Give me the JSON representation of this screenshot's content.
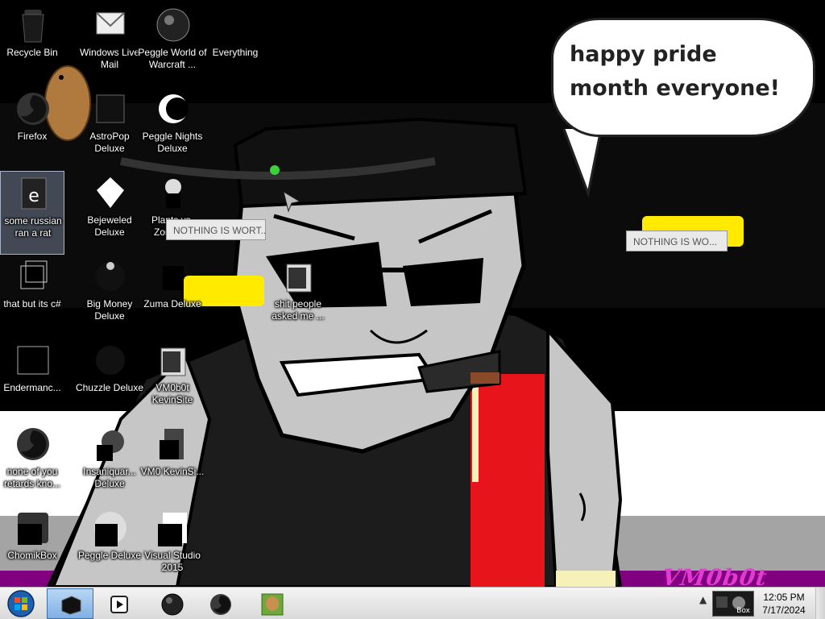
{
  "wallpaper": {
    "speech_bubble": "happy pride month everyone!",
    "signature": "VM0b0t",
    "colors": {
      "stripe_black": "#000000",
      "stripe_gray": "#a4a4a4",
      "stripe_white": "#ffffff",
      "stripe_purple": "#800080",
      "face": "#c6c6c6",
      "red_box": "#e8141c"
    }
  },
  "icons": [
    {
      "label": "Recycle Bin",
      "glyph": "recycle-bin-icon"
    },
    {
      "label": "Windows Live Mail",
      "glyph": "mail-icon"
    },
    {
      "label": "Peggle World of Warcraft ...",
      "glyph": "peggle-wow-icon"
    },
    {
      "label": "Everything",
      "glyph": "everything-icon"
    },
    {
      "label": "Firefox",
      "glyph": "firefox-icon"
    },
    {
      "label": "AstroPop Deluxe",
      "glyph": "astropop-icon"
    },
    {
      "label": "Peggle Nights Deluxe",
      "glyph": "peggle-nights-icon"
    },
    {
      "label": "some russian ran a rat",
      "glyph": "document-icon"
    },
    {
      "label": "Bejeweled Deluxe",
      "glyph": "bejeweled-icon"
    },
    {
      "label": "Plants vs. Zombies",
      "glyph": "pvz-icon"
    },
    {
      "label": "that but its c#",
      "glyph": "shortcut-icon"
    },
    {
      "label": "Big Money Deluxe",
      "glyph": "big-money-icon"
    },
    {
      "label": "Zuma Deluxe",
      "glyph": "zuma-icon"
    },
    {
      "label": "shit people asked me ...",
      "glyph": "folder-icon"
    },
    {
      "label": "Endermanc...",
      "glyph": "app-icon"
    },
    {
      "label": "Chuzzle Deluxe",
      "glyph": "chuzzle-icon"
    },
    {
      "label": "VM0b0t KevinSite",
      "glyph": "folder-icon"
    },
    {
      "label": "none of you retards kno...",
      "glyph": "firefox-icon"
    },
    {
      "label": "Insaniquar... Deluxe",
      "glyph": "insaniquarium-icon"
    },
    {
      "label": "VM0 KevinSi...",
      "glyph": "file-icon"
    },
    {
      "label": "ChomikBox",
      "glyph": "chomikbox-icon"
    },
    {
      "label": "Peggle Deluxe",
      "glyph": "peggle-icon"
    },
    {
      "label": "Visual Studio 2015",
      "glyph": "visual-studio-icon"
    }
  ],
  "popups": [
    {
      "text": "NOTHING IS WORT..."
    },
    {
      "text": "NOTHING IS WO..."
    }
  ],
  "taskbar": {
    "start": "start-orb",
    "items": [
      {
        "glyph": "black-box-app-icon",
        "active": true
      },
      {
        "glyph": "media-player-icon",
        "active": false
      },
      {
        "glyph": "dark-orb-app-icon",
        "active": false
      },
      {
        "glyph": "firefox-icon",
        "active": false
      },
      {
        "glyph": "chomikbox-icon",
        "active": false
      }
    ],
    "tray": {
      "app_text": "Box"
    },
    "clock": {
      "time": "12:05 PM",
      "date": "7/17/2024"
    }
  }
}
